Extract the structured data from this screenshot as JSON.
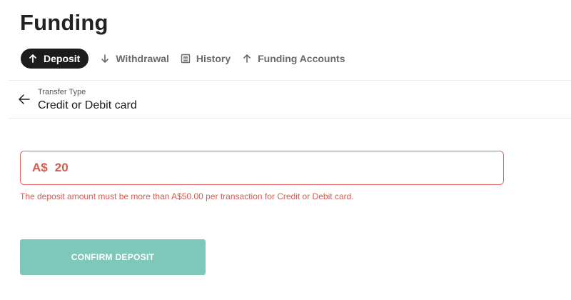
{
  "page": {
    "title": "Funding"
  },
  "tabs": [
    {
      "label": "Deposit",
      "icon": "arrow-up-icon",
      "active": true
    },
    {
      "label": "Withdrawal",
      "icon": "arrow-down-icon",
      "active": false
    },
    {
      "label": "History",
      "icon": "list-icon",
      "active": false
    },
    {
      "label": "Funding Accounts",
      "icon": "arrow-up-icon",
      "active": false
    }
  ],
  "transfer": {
    "label": "Transfer Type",
    "value": "Credit or Debit card"
  },
  "amount": {
    "currency": "A$",
    "value": "20"
  },
  "error": {
    "message": "The deposit amount must be more than A$50.00 per transaction for Credit or Debit card."
  },
  "actions": {
    "confirm_label": "CONFIRM DEPOSIT"
  },
  "colors": {
    "accent": "#7ec8b9",
    "error": "#d65a50",
    "active_tab_bg": "#1c1c1c"
  }
}
